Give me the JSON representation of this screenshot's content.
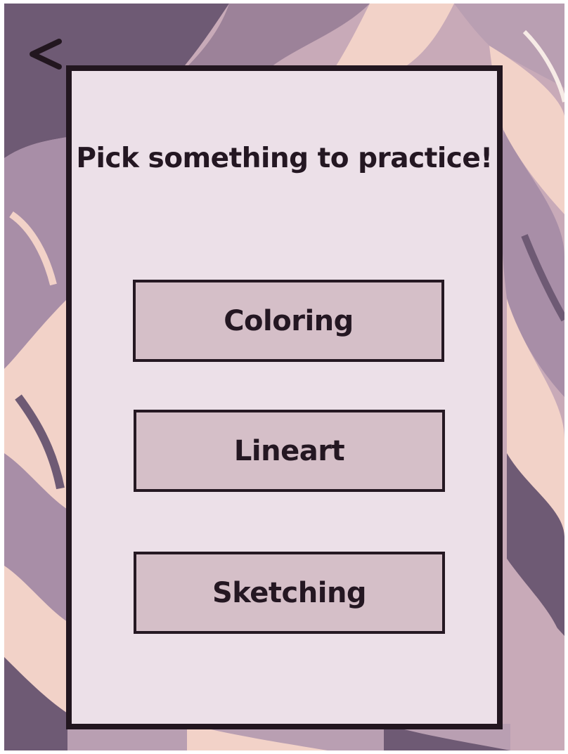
{
  "screen": {
    "title": "Pick something to practice!",
    "back_button": {
      "label": "<",
      "icon": "chevron-left-icon"
    },
    "options": [
      {
        "label": "Coloring"
      },
      {
        "label": "Lineart"
      },
      {
        "label": "Sketching"
      }
    ]
  },
  "colors": {
    "panel_background": "#ece0e8",
    "panel_border": "#22161f",
    "button_background": "#d5bfc8",
    "text": "#241722",
    "marble_light": "#f2d2c8",
    "marble_mauve": "#a88ea7",
    "marble_dark": "#6e5a74"
  }
}
